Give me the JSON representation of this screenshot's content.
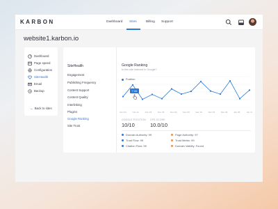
{
  "brand": {
    "logo_text": "KARBON"
  },
  "nav": {
    "items": [
      {
        "label": "Dashboard",
        "active": false
      },
      {
        "label": "Sites",
        "active": true
      },
      {
        "label": "Billing",
        "active": false
      },
      {
        "label": "Support",
        "active": false
      }
    ]
  },
  "topbar_icons": [
    "search-icon",
    "inbox-icon",
    "avatar"
  ],
  "page": {
    "title": "website1.karbon.io"
  },
  "left_nav": {
    "items": [
      {
        "label": "Dashboard",
        "icon": "dashboard-icon",
        "active": false
      },
      {
        "label": "Page speed",
        "icon": "calendar-icon",
        "active": false
      },
      {
        "label": "Configuration",
        "icon": "gear-icon",
        "active": false
      },
      {
        "label": "SiteHealth",
        "icon": "heart-icon",
        "active": true
      },
      {
        "label": "Email",
        "icon": "mail-icon",
        "active": false
      },
      {
        "label": "Backup",
        "icon": "backup-icon",
        "active": false
      }
    ],
    "back_label": "Back to sites"
  },
  "sitehealth_menu": {
    "title": "SiteHealth",
    "items": [
      {
        "label": "Engagement",
        "active": false
      },
      {
        "label": "Publishing Frequency",
        "active": false
      },
      {
        "label": "Content Support",
        "active": false
      },
      {
        "label": "Content Quality",
        "active": false
      },
      {
        "label": "Interlinking",
        "active": false
      },
      {
        "label": "Plugins",
        "active": false
      },
      {
        "label": "Google Ranking",
        "active": true
      },
      {
        "label": "Site Trust",
        "active": false
      }
    ]
  },
  "panel": {
    "title": "Google Ranking",
    "subtitle": "Is this site indexed in Google?",
    "legend_label": "Position",
    "tooltip_value": "7.34",
    "stats": [
      {
        "label": "GOOGLE POSITION",
        "value": "10/10"
      },
      {
        "label": "CPS SCORE",
        "value": "10.0/10"
      }
    ],
    "metrics": [
      {
        "label": "Domain Authority: 99",
        "color": "#2a78d8"
      },
      {
        "label": "Page Authority: 97",
        "color": "#e8944a"
      },
      {
        "label": "Trust Flow: 99",
        "color": "#2a78d8"
      },
      {
        "label": "Trust Metric: 99",
        "color": "#e8944a"
      },
      {
        "label": "Citation Flow: 99",
        "color": "#2a78d8"
      },
      {
        "label": "Domain Validity: Found",
        "color": "#e8944a"
      }
    ]
  },
  "chart_data": {
    "type": "line",
    "categories": [
      "Nov 04",
      "Nov 11",
      "Nov 18",
      "Nov 25",
      "Dec 02",
      "Dec 09",
      "Dec 16",
      "Dec 23",
      "Dec 30",
      "Jan 06",
      "Jan 13"
    ],
    "series": [
      {
        "name": "Position",
        "values": [
          3.5,
          7.3,
          2.6,
          4.2,
          2.8,
          6.0,
          4.3,
          5.2,
          8.4,
          5.3,
          4.3,
          8.6,
          2.8,
          5.6
        ]
      }
    ],
    "ylim": [
      0,
      10
    ],
    "grid": true,
    "legend": "top-left",
    "color": "#2a78d8"
  }
}
